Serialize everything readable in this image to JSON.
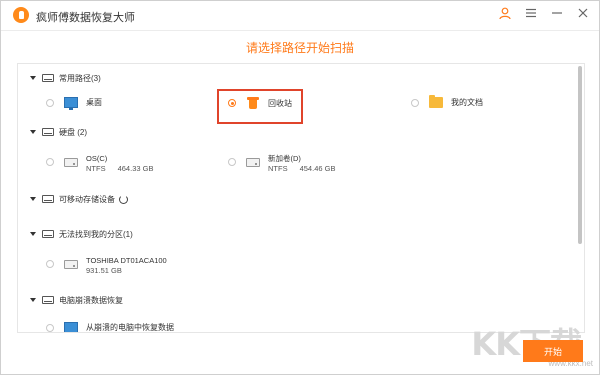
{
  "app": {
    "title": "疯师傅数据恢复大师"
  },
  "subtitle": "请选择路径开始扫描",
  "sections": {
    "common": {
      "label": "常用路径(3)"
    },
    "disks": {
      "label": "硬盘 (2)"
    },
    "removable": {
      "label": "可移动存储设备"
    },
    "lost_partitions": {
      "label": "无法找到我的分区(1)"
    },
    "crash": {
      "label": "电脑崩溃数据恢复"
    }
  },
  "common_items": [
    {
      "label": "桌面",
      "icon": "desktop-icon",
      "selected": false
    },
    {
      "label": "回收站",
      "icon": "recycle-bin-icon",
      "selected": true
    },
    {
      "label": "我的文档",
      "icon": "folder-icon",
      "selected": false
    }
  ],
  "disk_items": [
    {
      "name": "OS(C)",
      "fs": "NTFS",
      "size": "464.33 GB"
    },
    {
      "name": "新加卷(D)",
      "fs": "NTFS",
      "size": "454.46 GB"
    }
  ],
  "lost_partition_items": [
    {
      "name": "TOSHIBA DT01ACA100",
      "size": "931.51 GB"
    }
  ],
  "crash_items": [
    {
      "label": "从崩溃的电脑中恢复数据"
    }
  ],
  "start_button": {
    "label": "开始"
  },
  "watermark": {
    "text": "KK下载",
    "url": "www.kkx.net"
  },
  "colors": {
    "accent": "#ff7a1a",
    "highlight": "#e0442b"
  }
}
